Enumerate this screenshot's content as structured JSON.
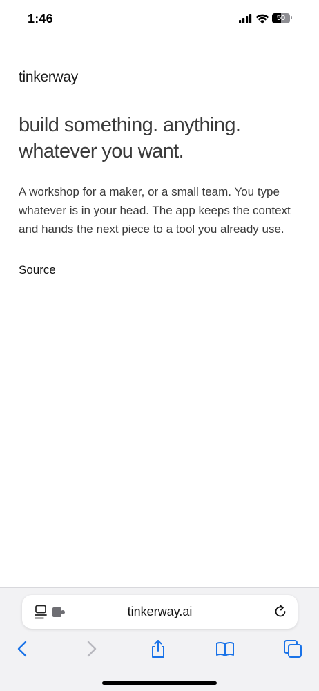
{
  "status_bar": {
    "time": "1:46",
    "battery_level": "50",
    "battery_fraction": 0.5
  },
  "page": {
    "brand": "tinkerway",
    "headline": "build something. anything. whatever you want.",
    "description": "A workshop for a maker, or a small team. You type whatever is in your head. The app keeps the context and hands the next piece to a tool you already use.",
    "source_link": "Source"
  },
  "browser": {
    "url": "tinkerway.ai",
    "accent_color": "#1a73e8"
  },
  "icons": [
    "signal-icon",
    "wifi-icon",
    "battery-icon",
    "page-menu-icon",
    "extension-icon",
    "reload-icon",
    "back-icon",
    "forward-icon",
    "share-icon",
    "bookmarks-icon",
    "tabs-icon"
  ]
}
